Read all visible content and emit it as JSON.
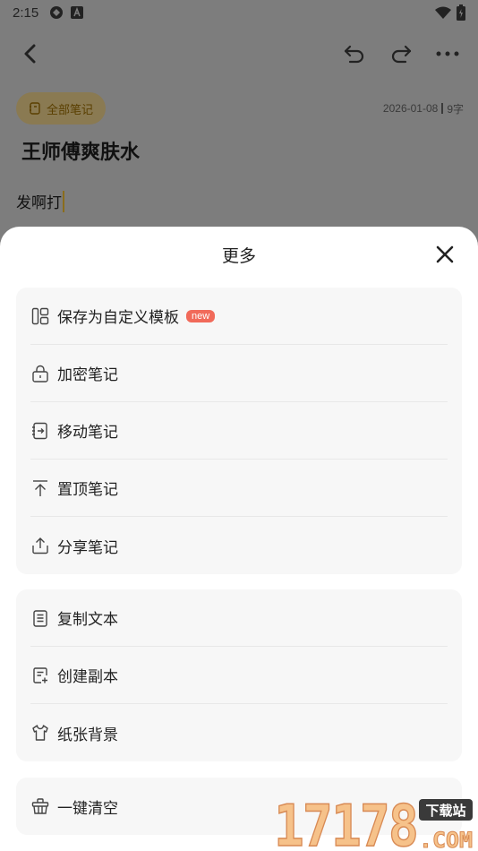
{
  "status_bar": {
    "time": "2:15"
  },
  "note": {
    "folder": "全部笔记",
    "date": "2026-01-08",
    "word_count": "9字",
    "title": "王师傅爽肤水",
    "body": "发啊打"
  },
  "sheet": {
    "title": "更多",
    "group1": [
      {
        "label": "保存为自定义模板",
        "badge": "new"
      },
      {
        "label": "加密笔记"
      },
      {
        "label": "移动笔记"
      },
      {
        "label": "置顶笔记"
      },
      {
        "label": "分享笔记"
      }
    ],
    "group2": [
      {
        "label": "复制文本"
      },
      {
        "label": "创建副本"
      },
      {
        "label": "纸张背景"
      }
    ],
    "group3": [
      {
        "label": "一键清空"
      }
    ]
  },
  "watermark": {
    "number": "17178",
    "tag": "下载站",
    "domain": ".COM"
  }
}
